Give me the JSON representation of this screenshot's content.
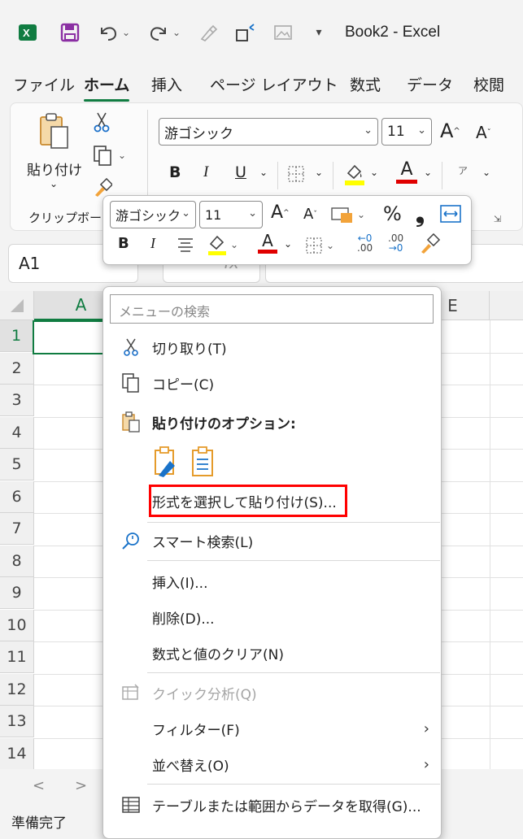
{
  "app": {
    "window_title": "Book2  -  Excel",
    "accent_color": "#107c41",
    "highlight_color": "#ff0000"
  },
  "quick_access": {
    "icons": [
      "excel-logo-icon",
      "save-icon",
      "undo-icon",
      "redo-icon",
      "format-painter-icon",
      "shape-icon",
      "picture-icon",
      "customize-icon"
    ]
  },
  "tabs": [
    {
      "label": "ファイル",
      "active": false
    },
    {
      "label": "ホーム",
      "active": true
    },
    {
      "label": "挿入",
      "active": false
    },
    {
      "label": "ページ レイアウト",
      "active": false
    },
    {
      "label": "数式",
      "active": false
    },
    {
      "label": "データ",
      "active": false
    },
    {
      "label": "校閲",
      "active": false
    }
  ],
  "ribbon": {
    "paste_label": "貼り付け",
    "clipboard_group_label": "クリップボード",
    "font_name": "游ゴシック",
    "font_size": "11",
    "bold": "B",
    "italic": "I",
    "underline": "U",
    "grow": "A",
    "shrink": "A",
    "font_color_letter": "A",
    "phonetic": "ア"
  },
  "mini_toolbar": {
    "font_name": "游ゴシック",
    "font_size": "11",
    "grow": "A",
    "shrink": "A",
    "percent": "%",
    "comma": "❟",
    "bold": "B",
    "italic": "I",
    "font_color_letter": "A",
    "increase_decimal": ".00",
    "decrease_decimal": ".00"
  },
  "formula_bar": {
    "name_box": "A1",
    "fx": "fx"
  },
  "grid": {
    "columns": [
      "A",
      "E"
    ],
    "rows": [
      "1",
      "2",
      "3",
      "4",
      "5",
      "6",
      "7",
      "8",
      "9",
      "10",
      "11",
      "12",
      "13",
      "14"
    ]
  },
  "sheet_nav": {
    "prev": "<",
    "next": ">"
  },
  "status": {
    "text": "準備完了"
  },
  "context_menu": {
    "search_placeholder": "メニューの検索",
    "items": [
      {
        "label": "切り取り(T)",
        "icon": "scissors-icon"
      },
      {
        "label": "コピー(C)",
        "icon": "copy-icon"
      },
      {
        "label": "貼り付けのオプション:",
        "icon": "paste-options-icon"
      },
      {
        "label": "形式を選択して貼り付け(S)...",
        "icon": ""
      },
      {
        "label": "スマート検索(L)",
        "icon": "smart-lookup-icon"
      },
      {
        "label": "挿入(I)...",
        "icon": ""
      },
      {
        "label": "削除(D)...",
        "icon": ""
      },
      {
        "label": "数式と値のクリア(N)",
        "icon": ""
      },
      {
        "label": "クイック分析(Q)",
        "icon": "quick-analysis-icon"
      },
      {
        "label": "フィルター(F)",
        "icon": ""
      },
      {
        "label": "並べ替え(O)",
        "icon": ""
      },
      {
        "label": "テーブルまたは範囲からデータを取得(G)...",
        "icon": "table-icon"
      }
    ]
  }
}
